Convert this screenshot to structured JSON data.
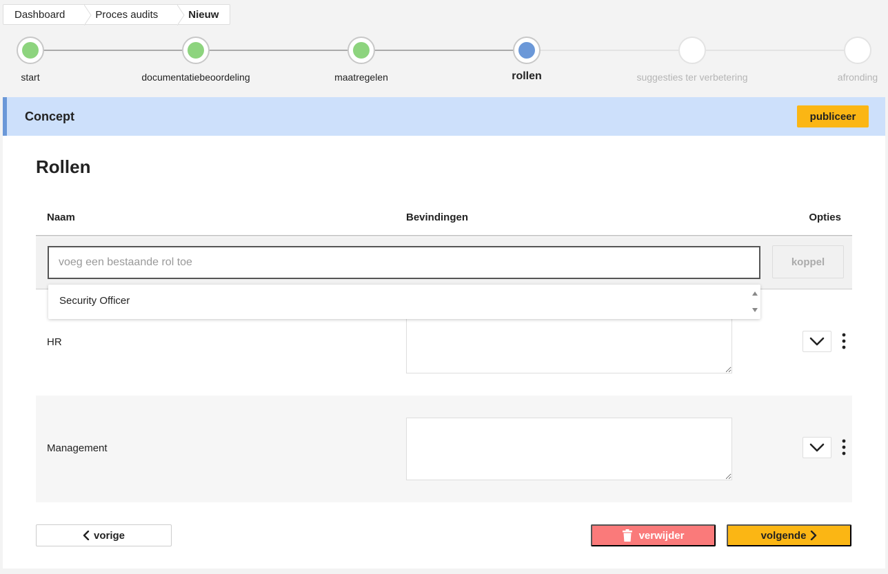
{
  "breadcrumb": {
    "items": [
      {
        "label": "Dashboard"
      },
      {
        "label": "Proces audits"
      },
      {
        "label": "Nieuw"
      }
    ]
  },
  "stepper": {
    "steps": [
      {
        "label": "start",
        "state": "done"
      },
      {
        "label": "documentatiebeoordeling",
        "state": "done"
      },
      {
        "label": "maatregelen",
        "state": "done"
      },
      {
        "label": "rollen",
        "state": "active"
      },
      {
        "label": "suggesties ter verbetering",
        "state": "todo"
      },
      {
        "label": "afronding",
        "state": "todo"
      }
    ]
  },
  "status_banner": {
    "title": "Concept",
    "publish_label": "publiceer"
  },
  "page": {
    "title": "Rollen"
  },
  "table": {
    "headers": {
      "name": "Naam",
      "findings": "Bevindingen",
      "options": "Opties"
    },
    "add_role": {
      "placeholder": "voeg een bestaande rol toe",
      "value": "",
      "button_label": "koppel"
    },
    "dropdown_options": [
      "Security Officer"
    ],
    "rows": [
      {
        "name": "HR",
        "findings": ""
      },
      {
        "name": "Management",
        "findings": ""
      }
    ]
  },
  "footer": {
    "prev_label": "vorige",
    "delete_label": "verwijder",
    "next_label": "volgende"
  },
  "colors": {
    "accent": "#fbb614",
    "done": "#8dd47e",
    "active": "#6b98d8",
    "danger": "#fa7a7a",
    "banner": "#cde0fb"
  }
}
